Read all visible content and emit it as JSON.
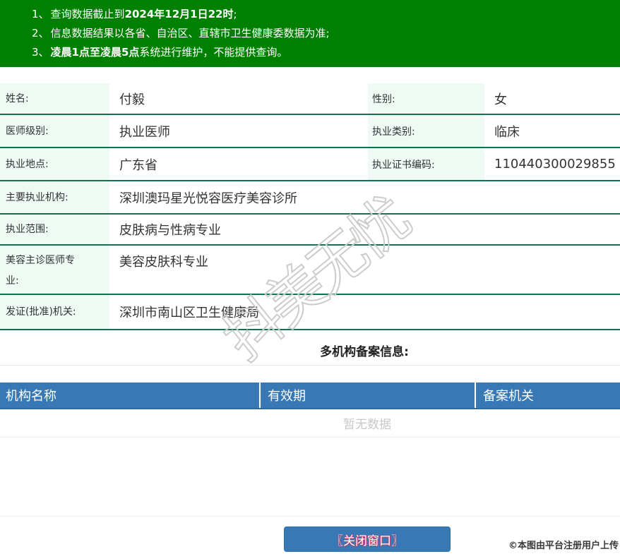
{
  "banner": {
    "notices": [
      {
        "num": "1、",
        "pre": "查询数据截止到",
        "bold": "2024年12月1日22时",
        "post": ";"
      },
      {
        "num": "2、",
        "pre": "信息数据结果以各省、自治区、直辖市卫生健康委数据为准;",
        "bold": "",
        "post": ""
      },
      {
        "num": "3、",
        "pre": "",
        "bold": "凌晨1点至凌晨5点",
        "post": "系统进行维护，不能提供查询。"
      }
    ]
  },
  "info": {
    "rows_duo": [
      {
        "label1": "姓名:",
        "value1": "付毅",
        "label2": "性别:",
        "value2": "女"
      },
      {
        "label1": "医师级别:",
        "value1": "执业医师",
        "label2": "执业类别:",
        "value2": "临床"
      },
      {
        "label1": "执业地点:",
        "value1": "广东省",
        "label2": "执业证书编码:",
        "value2": "110440300029855"
      }
    ],
    "rows_full": [
      {
        "label": "主要执业机构:",
        "value": "深圳澳玛星光悦容医疗美容诊所"
      },
      {
        "label": "执业范围:",
        "value": "皮肤病与性病专业"
      },
      {
        "label": "美容主诊医师专业:",
        "value": "美容皮肤科专业"
      },
      {
        "label": "发证(批准)机关:",
        "value": "深圳市南山区卫生健康局"
      }
    ]
  },
  "filing": {
    "title": "多机构备案信息:",
    "headers": [
      "机构名称",
      "有效期",
      "备案机关"
    ],
    "empty_text": "暂无数据"
  },
  "footer": {
    "close_button": "〖关闭窗口〗",
    "upload_watermark": "©本图由平台注册用户上传"
  },
  "watermark_text": "抖美无忧",
  "colors": {
    "banner_green": "#008000",
    "label_cell_bg": "#eefaf3",
    "row_border_green": "#11704e",
    "header_blue": "#3879b5",
    "empty_text_gray": "#c8c8c8"
  }
}
